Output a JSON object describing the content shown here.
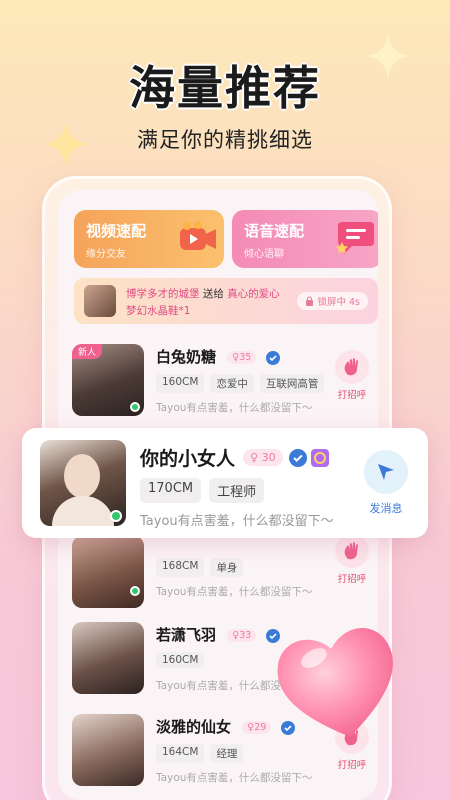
{
  "hero": {
    "title": "海量推荐",
    "subtitle": "满足你的精挑细选"
  },
  "match": {
    "video": {
      "title": "视频速配",
      "sub": "缘分交友"
    },
    "voice": {
      "title": "语音速配",
      "sub": "倾心语聊"
    }
  },
  "gift": {
    "sender": "博学多才的城堡",
    "verb": "送给",
    "receiver": "真心的爱心",
    "item": "梦幻水晶鞋*1",
    "lock": "锁屏中 4s"
  },
  "users": [
    {
      "name": "白兔奶糖",
      "age": "35",
      "tags": [
        "160CM",
        "恋爱中",
        "互联网高管"
      ],
      "bio": "Tayou有点害羞，什么都没留下～",
      "action": "打招呼",
      "badge": "新人",
      "online": true
    },
    {
      "name": "",
      "age": "",
      "tags": [
        "168CM",
        "单身"
      ],
      "bio": "Tayou有点害羞，什么都没留下～",
      "action": "打招呼",
      "online": true
    },
    {
      "name": "若潇飞羽",
      "age": "33",
      "tags": [
        "160CM"
      ],
      "bio": "Tayou有点害羞，什么都没留下～",
      "action": "",
      "online": false
    },
    {
      "name": "淡雅的仙女",
      "age": "29",
      "tags": [
        "164CM",
        "经理"
      ],
      "bio": "Tayou有点害羞，什么都没留下～",
      "action": "打招呼",
      "online": false
    }
  ],
  "featured": {
    "name": "你的小女人",
    "age": "30",
    "tags": [
      "170CM",
      "工程师"
    ],
    "bio": "Tayou有点害羞，什么都没留下～",
    "action": "发消息",
    "online": true
  },
  "colors": {
    "accent": "#f0608e",
    "online": "#2fc86a",
    "verify": "#3b7bd8"
  }
}
